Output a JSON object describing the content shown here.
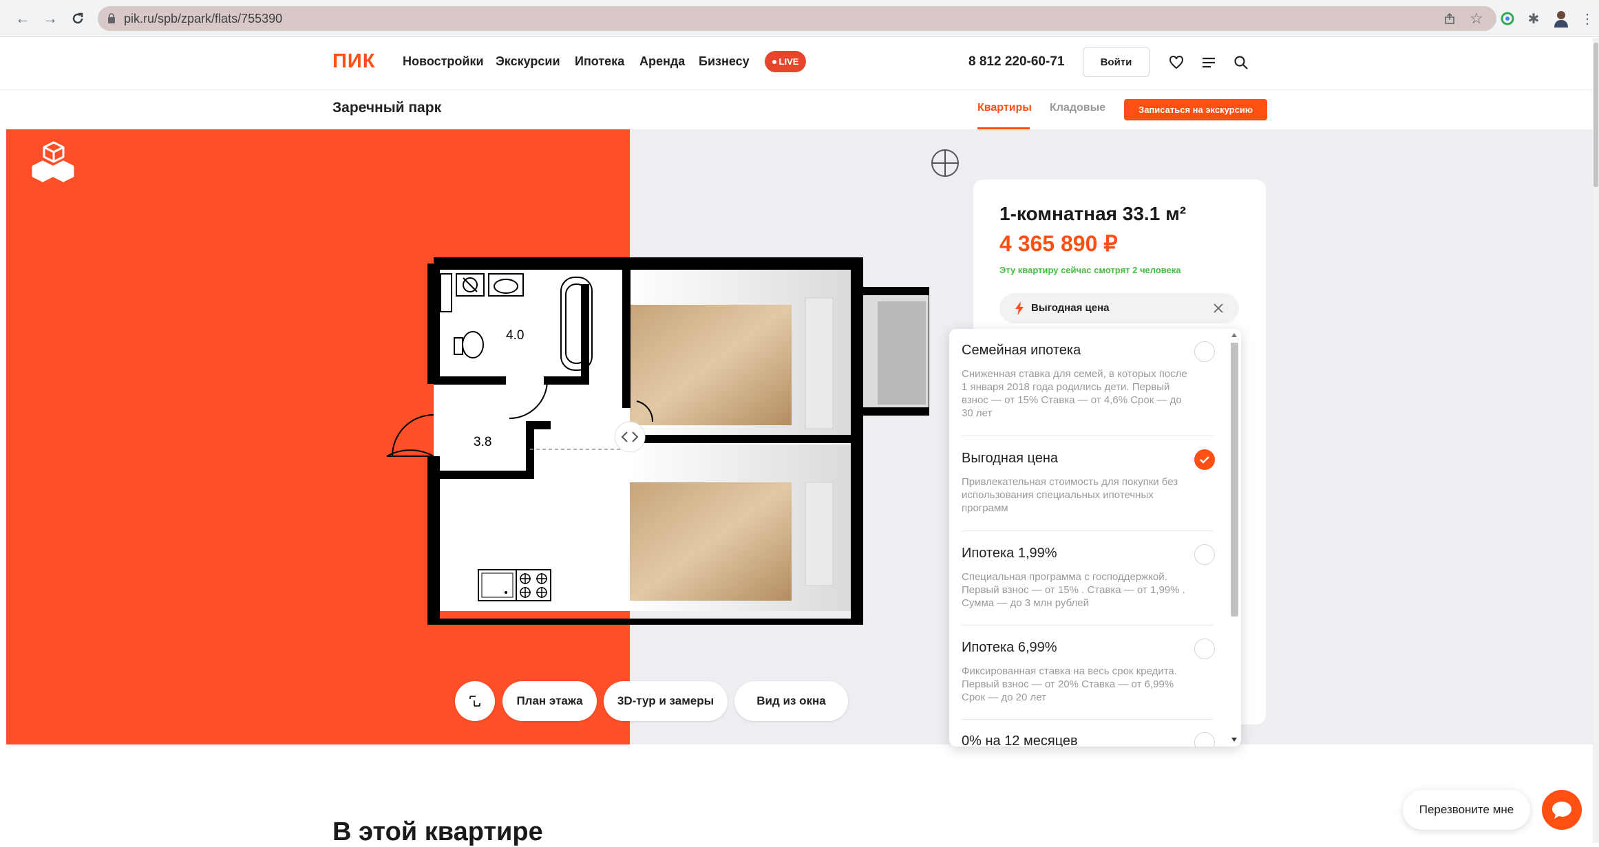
{
  "browser": {
    "url": "pik.ru/spb/zpark/flats/755390",
    "nav_icons": [
      "back-arrow-icon",
      "forward-arrow-icon",
      "reload-icon"
    ],
    "extension_icons": [
      "share-icon",
      "star-icon",
      "extension-icon",
      "puzzle-icon",
      "profile-icon",
      "kebab-menu-icon"
    ]
  },
  "header": {
    "logo": "ПИК",
    "nav": [
      "Новостройки",
      "Экскурсии",
      "Ипотека",
      "Аренда",
      "Бизнесу"
    ],
    "live": "LIVE",
    "phone": "8 812 220-60-71",
    "login": "Войти"
  },
  "subheader": {
    "project": "Заречный парк",
    "tab_flats": "Квартиры",
    "tab_storage": "Кладовые",
    "excursion_button": "Записаться на экскурсию"
  },
  "plan": {
    "room_1": "4.0",
    "room_2": "3.8"
  },
  "view_buttons": {
    "floor_plan": "План этажа",
    "tour": "3D-тур и замеры",
    "window_view": "Вид из окна"
  },
  "card": {
    "title": "1-комнатная 33.1 м²",
    "price": "4 365 890 ₽",
    "watching": "Эту квартиру сейчас смотрят 2 человека",
    "selected_offer": "Выгодная цена"
  },
  "offers": [
    {
      "title": "Семейная ипотека",
      "desc": "Сниженная ставка для семей, в которых после 1 января 2018 года родились дети. Первый взнос — от 15% Ставка — от 4,6% Срок — до 30 лет",
      "checked": false
    },
    {
      "title": "Выгодная цена",
      "desc": "Привлекательная стоимость для покупки без использования специальных ипотечных программ",
      "checked": true
    },
    {
      "title": "Ипотека 1,99%",
      "desc": "Специальная программа с господдержкой. Первый взнос — от 15% . Ставка — от 1,99% . Сумма — до 3 млн рублей",
      "checked": false
    },
    {
      "title": "Ипотека 6,99%",
      "desc": "Фиксированная ставка на весь срок кредита. Первый взнос — от 20% Ставка — от 6,99% Срок — до 20 лет",
      "checked": false
    },
    {
      "title": "0% на 12 месяцев",
      "desc": "",
      "checked": false
    }
  ],
  "section_heading": "В этой квартире",
  "callback": "Перезвоните мне",
  "colors": {
    "brand": "#ff4f12",
    "hero_orange": "#ff4f28",
    "live_red": "#e8452c",
    "green": "#3fbf3f"
  }
}
